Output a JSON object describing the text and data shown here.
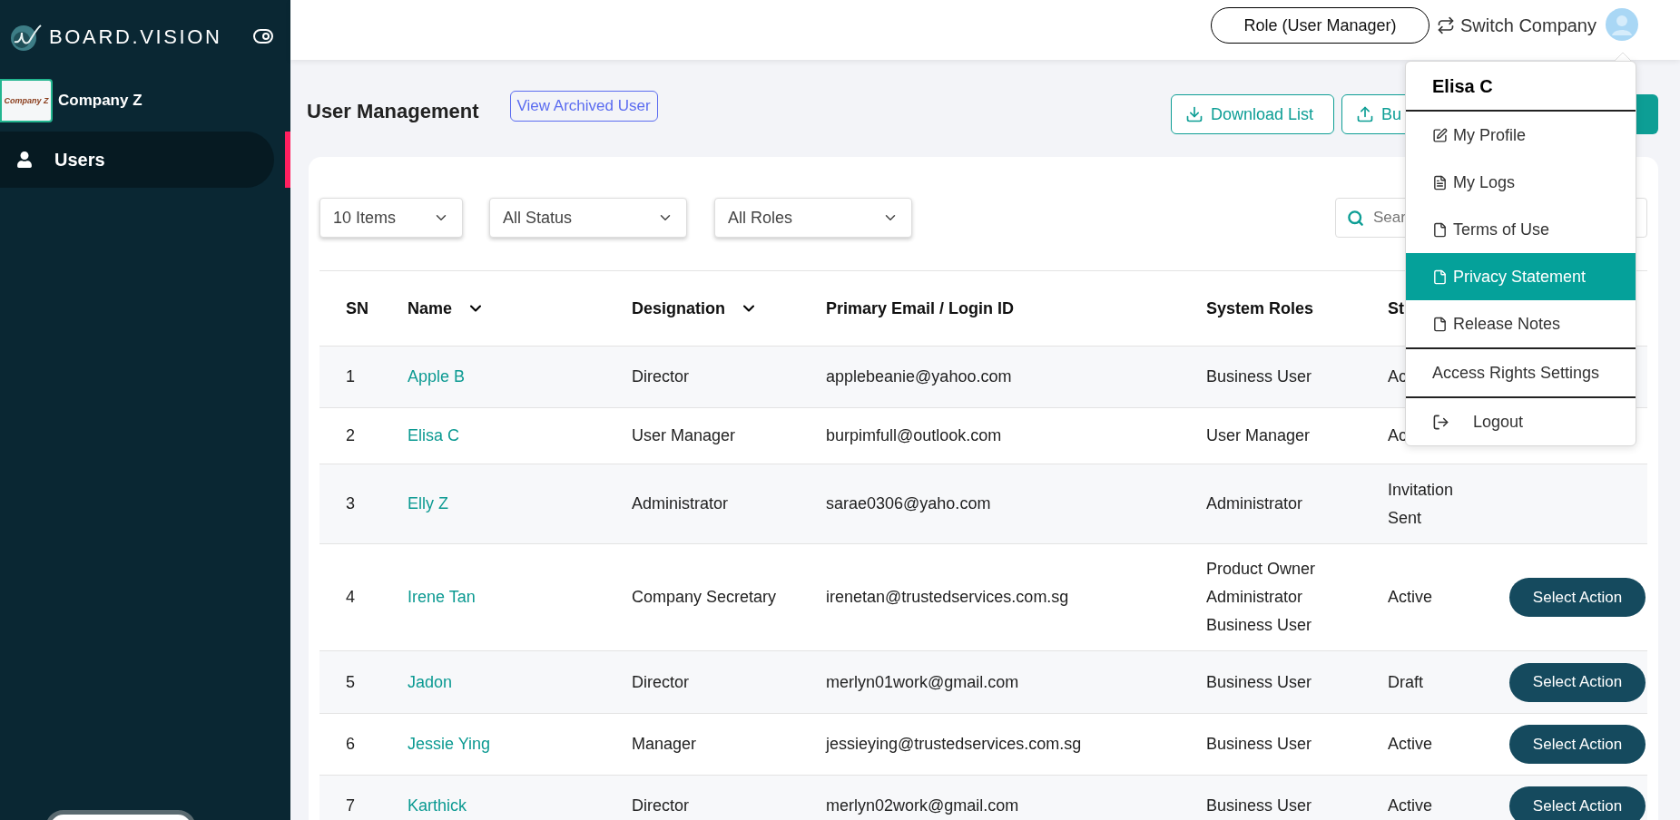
{
  "sidebar": {
    "brand": "BOARD.VISION",
    "company": {
      "name": "Company Z",
      "logo_text": "Company Z"
    },
    "items": [
      {
        "label": "Users",
        "kind": "person",
        "selected": true
      }
    ],
    "bottom_control": {
      "kind": "pill"
    }
  },
  "header": {
    "role_button": "Role (User Manager)",
    "switch_company": "Switch Company"
  },
  "page": {
    "title": "User Management",
    "archived_link": "View Archived User",
    "toolbar": [
      {
        "label": "Download List",
        "kind": "download"
      },
      {
        "label": "Bu",
        "kind": "upload"
      },
      {
        "kind": "filled"
      }
    ]
  },
  "filters": [
    {
      "value": "10 Items"
    },
    {
      "value": "All Status"
    },
    {
      "value": "All Roles"
    }
  ],
  "search": {
    "placeholder": "Sear"
  },
  "table": {
    "columns": [
      {
        "label": "SN",
        "sortable": false
      },
      {
        "label": "Name",
        "sortable": true
      },
      {
        "label": "Designation",
        "sortable": true
      },
      {
        "label": "Primary Email / Login ID",
        "sortable": false
      },
      {
        "label": "System Roles",
        "sortable": false
      },
      {
        "label": "St",
        "sortable": false
      }
    ],
    "rows": [
      {
        "sn": "1",
        "name": "Apple B",
        "designation": "Director",
        "email": "applebeanie@yahoo.com",
        "roles": [
          "Business User"
        ],
        "status": [
          "Ac"
        ]
      },
      {
        "sn": "2",
        "name": "Elisa C",
        "designation": "User Manager",
        "email": "burpimfull@outlook.com",
        "roles": [
          "User Manager"
        ],
        "status": [
          "Ac"
        ]
      },
      {
        "sn": "3",
        "name": "Elly Z",
        "designation": "Administrator",
        "email": "sarae0306@yaho.com",
        "roles": [
          "Administrator"
        ],
        "status": [
          "Invitation",
          "Sent"
        ]
      },
      {
        "sn": "4",
        "name": "Irene Tan",
        "designation": "Company Secretary",
        "email": "irenetan@trustedservices.com.sg",
        "roles": [
          "Product Owner",
          "Administrator",
          "Business User"
        ],
        "status": [
          "Active"
        ],
        "action": "Select Action"
      },
      {
        "sn": "5",
        "name": "Jadon",
        "designation": "Director",
        "email": "merlyn01work@gmail.com",
        "roles": [
          "Business User"
        ],
        "status": [
          "Draft"
        ],
        "action": "Select Action"
      },
      {
        "sn": "6",
        "name": "Jessie Ying",
        "designation": "Manager",
        "email": "jessieying@trustedservices.com.sg",
        "roles": [
          "Business User"
        ],
        "status": [
          "Active"
        ],
        "action": "Select Action"
      },
      {
        "sn": "7",
        "name": "Karthick",
        "designation": "Director",
        "email": "merlyn02work@gmail.com",
        "roles": [
          "Business User"
        ],
        "status": [
          "Active"
        ],
        "action": "Select Action"
      }
    ]
  },
  "menu": {
    "user_name": "Elisa C",
    "sections": [
      [
        {
          "label": "My Profile",
          "kind": "edit",
          "selected": false
        },
        {
          "label": "My Logs",
          "kind": "log",
          "selected": false
        },
        {
          "label": "Terms of Use",
          "kind": "document",
          "selected": false
        },
        {
          "label": "Privacy Statement",
          "kind": "document",
          "selected": true
        },
        {
          "label": "Release Notes",
          "kind": "document",
          "selected": false
        }
      ],
      [
        {
          "label": "Access Rights Settings",
          "selected": false
        }
      ],
      [
        {
          "label": "Logout",
          "kind": "logout",
          "selected": false
        }
      ]
    ]
  }
}
